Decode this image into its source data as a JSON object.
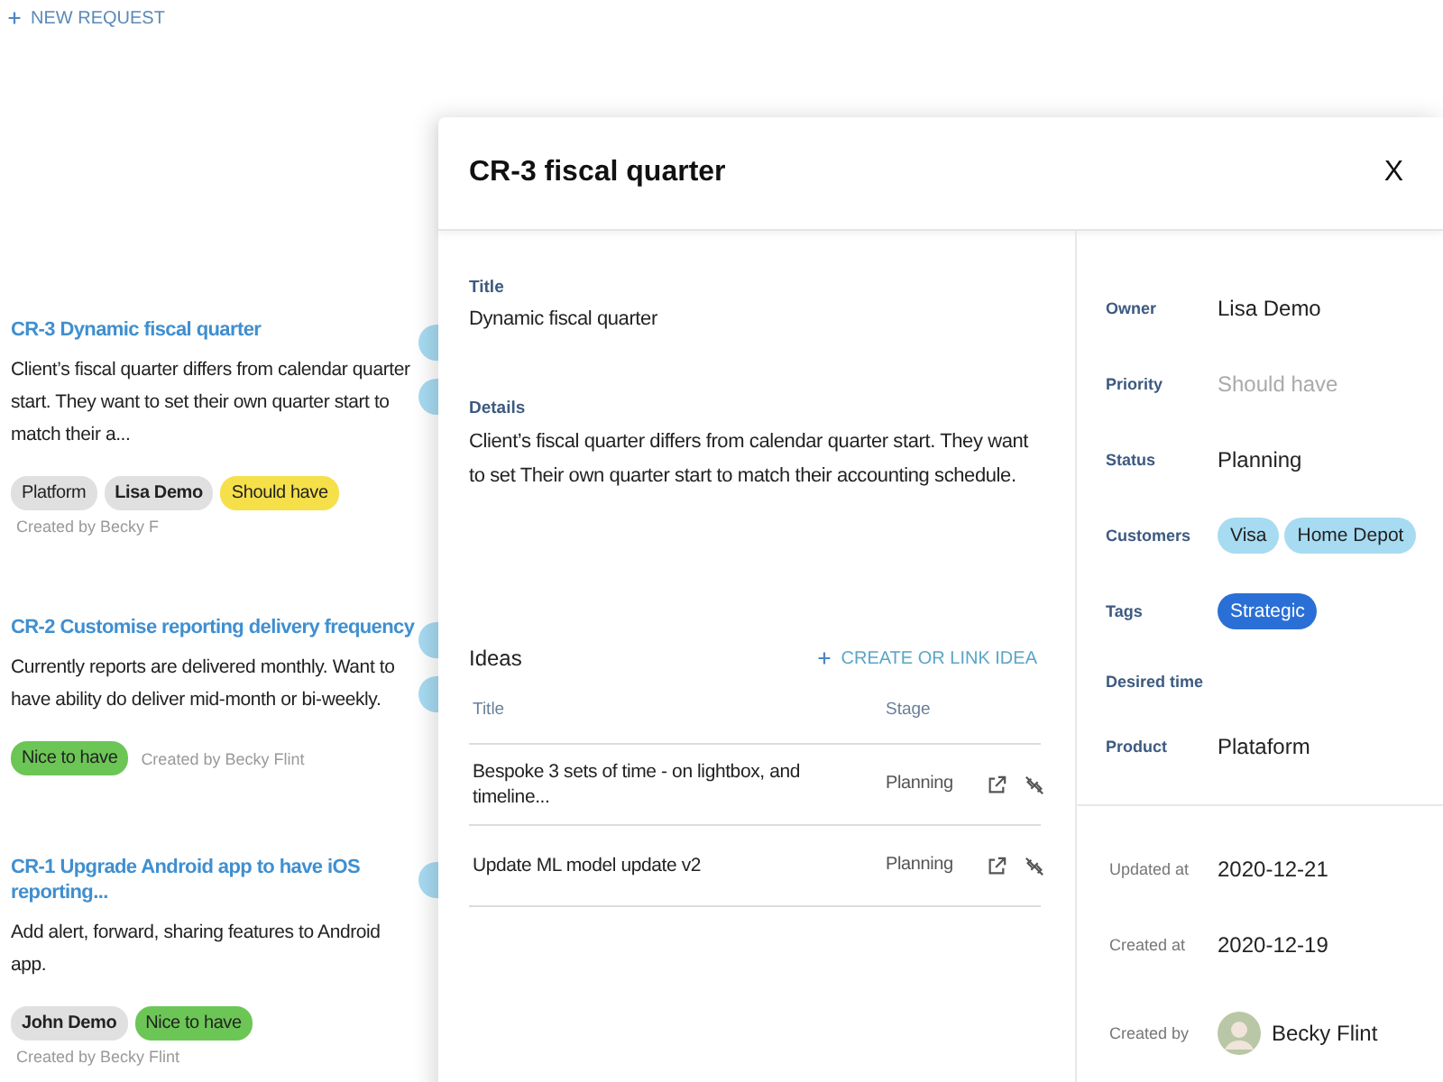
{
  "toolbar": {
    "new_request": "NEW REQUEST"
  },
  "requests": [
    {
      "title": "CR-3 Dynamic fiscal quarter",
      "description": "Client’s fiscal quarter differs from calendar quarter start. They want to set their own quarter start to match their a...",
      "chips": [
        {
          "label": "Platform",
          "color": "#e0e0e0",
          "bold": false
        },
        {
          "label": "Lisa Demo",
          "color": "#e0e0e0",
          "bold": true
        },
        {
          "label": "Should have",
          "color": "#f5e04a",
          "bold": false
        }
      ],
      "created": "Created by Becky F",
      "side_badges": [
        {
          "color": "#a7dbf2"
        },
        {
          "color": "#a7dbf2"
        }
      ]
    },
    {
      "title": "CR-2 Customise reporting delivery frequency",
      "description": "Currently reports are delivered monthly. Want to have ability do deliver mid-month or bi-weekly.",
      "chips": [
        {
          "label": "Nice to have",
          "color": "#6cc655",
          "bold": false
        }
      ],
      "created": "Created by Becky Flint",
      "side_badges": [
        {
          "color": "#a7dbf2"
        },
        {
          "color": "#a7dbf2"
        }
      ]
    },
    {
      "title": "CR-1 Upgrade Android app to have iOS reporting...",
      "description": "Add alert, forward, sharing features to Android app.",
      "chips": [
        {
          "label": "John Demo",
          "color": "#e0e0e0",
          "bold": true
        },
        {
          "label": "Nice to have",
          "color": "#6cc655",
          "bold": false
        }
      ],
      "created": "Created by Becky Flint",
      "side_badges": [
        {
          "color": "#a7dbf2"
        }
      ]
    }
  ],
  "panel": {
    "title": "CR-3 fiscal quarter",
    "close": "X",
    "title_label": "Title",
    "title_value": "Dynamic fiscal quarter",
    "details_label": "Details",
    "details_value": "Client’s fiscal quarter differs from calendar quarter start. They want to set Their own quarter start to match their accounting schedule.",
    "ideas": {
      "heading": "Ideas",
      "action": "CREATE OR LINK IDEA",
      "columns": [
        "Title",
        "Stage"
      ],
      "rows": [
        {
          "title": "Bespoke 3 sets of time - on lightbox, and timeline...",
          "stage": "Planning"
        },
        {
          "title": "Update ML model update v2",
          "stage": "Planning"
        }
      ]
    },
    "fields": [
      {
        "label": "Owner",
        "kind": "text",
        "value": "Lisa Demo"
      },
      {
        "label": "Priority",
        "kind": "text",
        "placeholder": "Should have"
      },
      {
        "label": "Status",
        "kind": "text",
        "value": "Planning"
      },
      {
        "label": "Customers",
        "kind": "chips",
        "chips": [
          {
            "label": "Visa",
            "color": "#a7dbf2"
          },
          {
            "label": "Home Depot",
            "color": "#a7dbf2"
          }
        ]
      },
      {
        "label": "Tags",
        "kind": "chips",
        "chips": [
          {
            "label": "Strategic",
            "color": "#2a6fd6"
          }
        ]
      },
      {
        "label": "Desired time",
        "kind": "empty"
      },
      {
        "label": "Product",
        "kind": "text",
        "value": "Plataform"
      }
    ],
    "meta": [
      {
        "label": "Updated at",
        "kind": "text",
        "value": "2020-12-21"
      },
      {
        "label": "Created at",
        "kind": "text",
        "value": "2020-12-19"
      },
      {
        "label": "Created by",
        "kind": "user",
        "value": "Becky Flint"
      }
    ]
  }
}
